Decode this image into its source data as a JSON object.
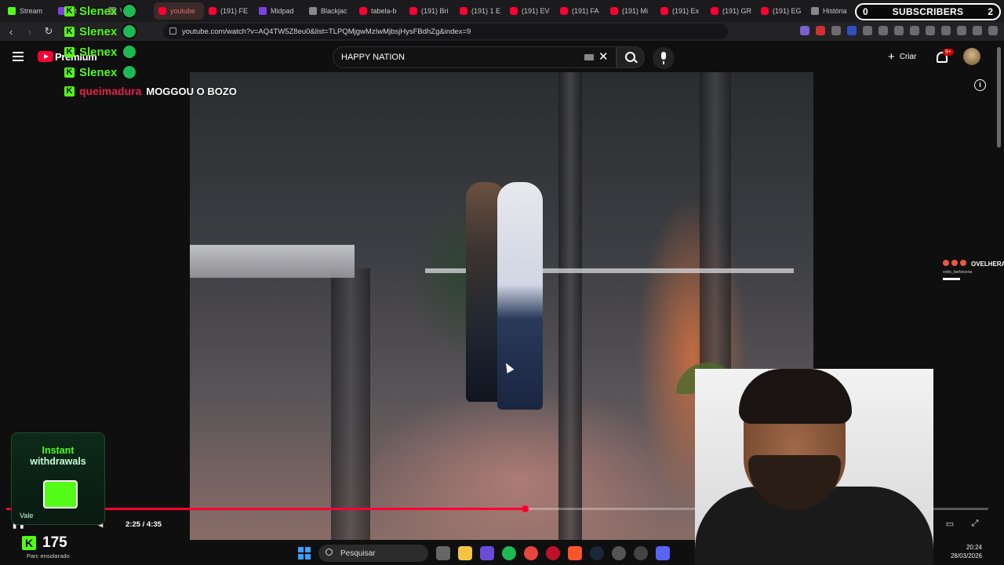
{
  "browser": {
    "tabs": [
      {
        "label": "Stream",
        "fav": "kick"
      },
      {
        "label": "vit",
        "fav": "purple"
      },
      {
        "label": "Vo",
        "fav": "gray"
      },
      {
        "label": "youtube",
        "fav": "yt",
        "active": true
      },
      {
        "label": "(191) FE",
        "fav": "yt"
      },
      {
        "label": "Midpad",
        "fav": "purple"
      },
      {
        "label": "Blackjac",
        "fav": "gray"
      },
      {
        "label": "tabela-b",
        "fav": "yt"
      },
      {
        "label": "(191) Bri",
        "fav": "yt"
      },
      {
        "label": "(191) 1 E",
        "fav": "yt"
      },
      {
        "label": "(191) EV",
        "fav": "yt"
      },
      {
        "label": "(191) FA",
        "fav": "yt"
      },
      {
        "label": "(191) Mi",
        "fav": "yt"
      },
      {
        "label": "(191) Ex",
        "fav": "yt"
      },
      {
        "label": "(191) GR",
        "fav": "yt"
      },
      {
        "label": "(191) EG",
        "fav": "yt"
      },
      {
        "label": "História",
        "fav": "gray"
      }
    ],
    "url": "youtube.com/watch?v=AQ4TW5Z8eu0&list=TLPQMjgwMzIwMjbsjHysFBdhZg&index=9"
  },
  "youtube": {
    "brand": "Premium",
    "search_value": "HAPPY NATION",
    "create_label": "Criar",
    "notif_badge": "9+"
  },
  "player": {
    "time": "2:25 / 4:35",
    "progress_fraction": 0.527
  },
  "overlay": {
    "chat": [
      {
        "user": "Slenex",
        "message": ""
      },
      {
        "user": "Slenex",
        "message": ""
      },
      {
        "user": "Slenex",
        "message": ""
      },
      {
        "user": "Slenex",
        "message": ""
      },
      {
        "user": "queimadura",
        "message": "MOGGOU O BOZO"
      }
    ],
    "promo_line1": "Instant",
    "promo_line2": "withdrawals",
    "promo_button": "Vale",
    "viewer_count": "175",
    "weather": "Parc ensolarado",
    "subs_left": "0",
    "subs_label": "SUBSCRIBERS",
    "subs_right": "2",
    "alert_name": "OVELHERA",
    "alert_sub": "votto_barbocena"
  },
  "taskbar": {
    "search_placeholder": "Pesquisar",
    "time": "20:24",
    "date": "28/03/2026"
  },
  "colors": {
    "kick_green": "#53fc18",
    "yt_red": "#ff0033"
  }
}
